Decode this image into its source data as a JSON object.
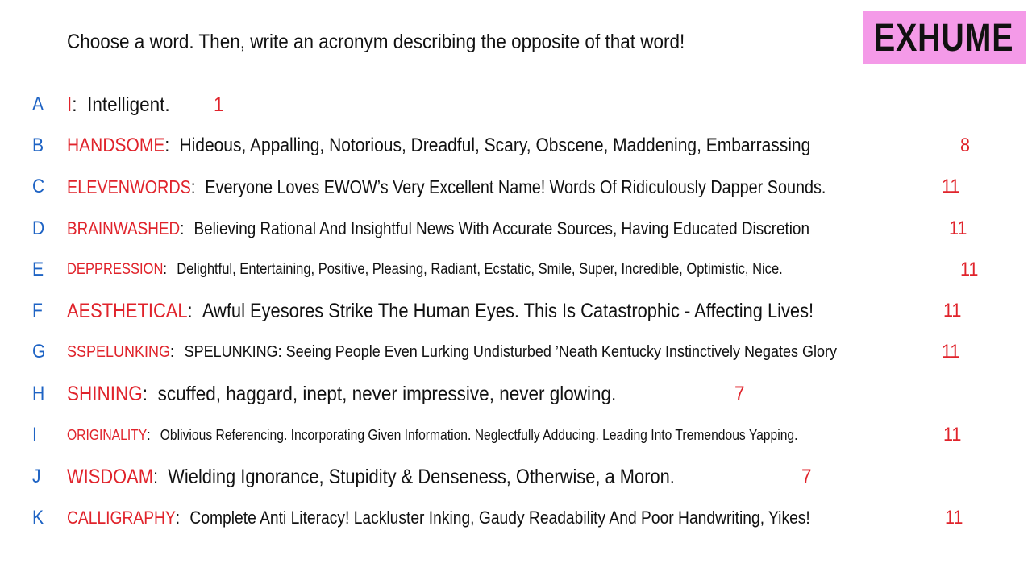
{
  "prompt": "Choose a word. Then, write an acronym describing the opposite of that word!",
  "badge": "EXHUME",
  "colors": {
    "letter": "#1e63c4",
    "word": "#e0232b",
    "badge_bg": "#f49ae8"
  },
  "entries": [
    {
      "letter": "A",
      "word": "I",
      "description": "Intelligent.",
      "score": "1"
    },
    {
      "letter": "B",
      "word": "HANDSOME",
      "description": "Hideous, Appalling, Notorious, Dreadful, Scary, Obscene, Maddening, Embarrassing",
      "score": "8"
    },
    {
      "letter": "C",
      "word": "ELEVENWORDS",
      "description": "Everyone Loves EWOW’s Very Excellent Name! Words Of Ridiculously Dapper Sounds.",
      "score": "11"
    },
    {
      "letter": "D",
      "word": "BRAINWASHED",
      "description": "Believing Rational And Insightful News With Accurate Sources, Having Educated Discretion",
      "score": "11"
    },
    {
      "letter": "E",
      "word": "DEPPRESSION",
      "description": "Delightful, Entertaining, Positive, Pleasing, Radiant, Ecstatic, Smile, Super, Incredible, Optimistic, Nice.",
      "score": "11"
    },
    {
      "letter": "F",
      "word": "AESTHETICAL",
      "description": "Awful Eyesores Strike The Human Eyes. This Is Catastrophic - Affecting Lives!",
      "score": "11"
    },
    {
      "letter": "G",
      "word": "SSPELUNKING",
      "description": "SPELUNKING: Seeing People Even Lurking Undisturbed ’Neath Kentucky Instinctively Negates Glory",
      "score": "11"
    },
    {
      "letter": "H",
      "word": "SHINING",
      "description": "scuffed, haggard, inept, never impressive, never glowing.",
      "score": "7"
    },
    {
      "letter": "I",
      "word": "ORIGINALITY",
      "description": "Oblivious Referencing. Incorporating Given Information. Neglectfully Adducing. Leading Into Tremendous Yapping.",
      "score": "11"
    },
    {
      "letter": "J",
      "word": "WISDOAM",
      "description": "Wielding Ignorance, Stupidity & Denseness, Otherwise, a Moron.",
      "score": "7"
    },
    {
      "letter": "K",
      "word": "CALLIGRAPHY",
      "description": "Complete Anti Literacy! Lackluster Inking, Gaudy Readability And Poor Handwriting, Yikes!",
      "score": "11"
    }
  ]
}
